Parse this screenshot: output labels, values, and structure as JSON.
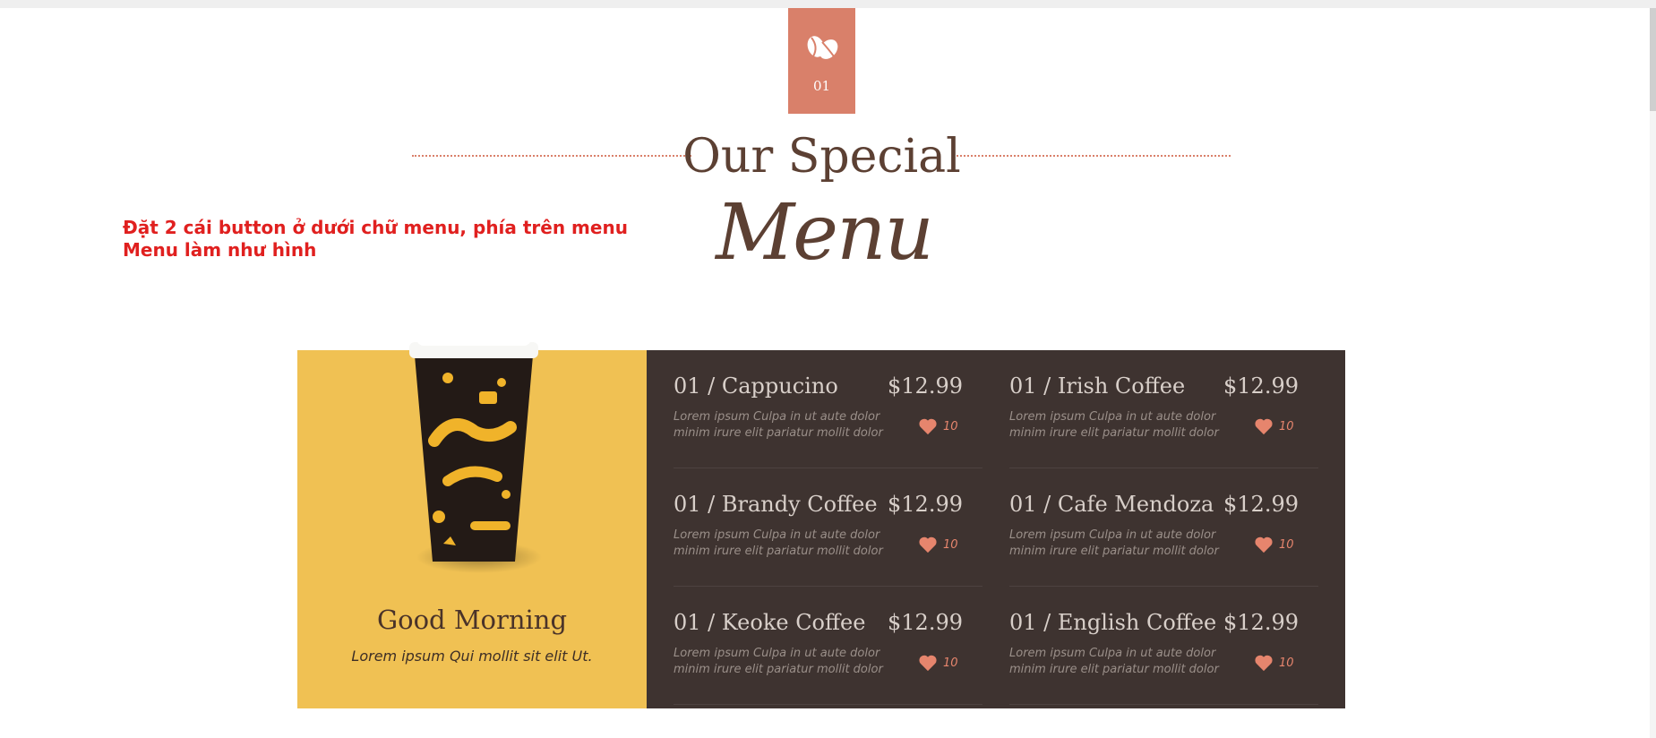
{
  "badge": {
    "number": "01",
    "icon": "coffee-beans-icon"
  },
  "heading": {
    "line1": "Our Special",
    "line2": "Menu"
  },
  "note": {
    "line1": "Đặt 2 cái button ở dưới chữ  menu, phía trên menu",
    "line2": "Menu làm như hình"
  },
  "promo": {
    "title": "Good Morning",
    "subtitle": "Lorem ipsum Qui mollit sit elit Ut.",
    "image": "coffee-to-go-cup"
  },
  "menu": {
    "items": [
      {
        "name": "01 / Cappucino",
        "price": "$12.99",
        "desc": "Lorem ipsum Culpa in ut aute dolor minim irure elit pariatur mollit dolor",
        "likes": "10"
      },
      {
        "name": "01 / Irish Coffee",
        "price": "$12.99",
        "desc": "Lorem ipsum Culpa in ut aute dolor minim irure elit pariatur mollit dolor",
        "likes": "10"
      },
      {
        "name": "01 / Brandy Coffee",
        "price": "$12.99",
        "desc": "Lorem ipsum Culpa in ut aute dolor minim irure elit pariatur mollit dolor",
        "likes": "10"
      },
      {
        "name": "01 / Cafe Mendoza",
        "price": "$12.99",
        "desc": "Lorem ipsum Culpa in ut aute dolor minim irure elit pariatur mollit dolor",
        "likes": "10"
      },
      {
        "name": "01 / Keoke Coffee",
        "price": "$12.99",
        "desc": "Lorem ipsum Culpa in ut aute dolor minim irure elit pariatur mollit dolor",
        "likes": "10"
      },
      {
        "name": "01 / English Coffee",
        "price": "$12.99",
        "desc": "Lorem ipsum Culpa in ut aute dolor minim irure elit pariatur mollit dolor",
        "likes": "10"
      }
    ]
  },
  "colors": {
    "accent": "#d9806a",
    "dark": "#3e3330",
    "yellow": "#f0c153",
    "brown": "#5c4033",
    "note_red": "#e0201f"
  }
}
